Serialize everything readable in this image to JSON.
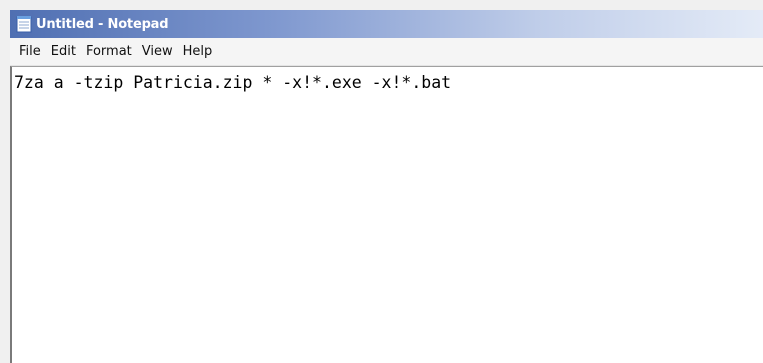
{
  "window": {
    "title": "Untitled - Notepad",
    "icon": "notepad-icon"
  },
  "menu": {
    "items": [
      "File",
      "Edit",
      "Format",
      "View",
      "Help"
    ]
  },
  "editor": {
    "content": "7za a -tzip Patricia.zip * -x!*.exe -x!*.bat"
  }
}
